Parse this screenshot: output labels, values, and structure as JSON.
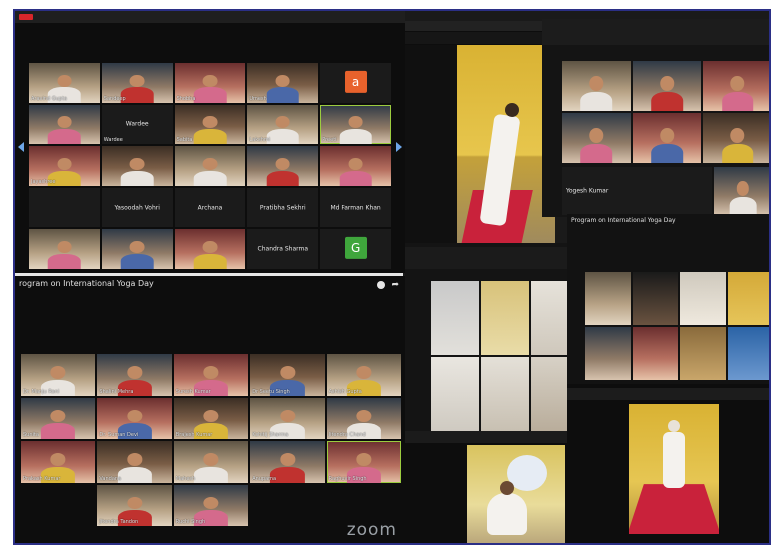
{
  "frame": {
    "border_color": "#2b2f86"
  },
  "main_window": {
    "titlebar_text": "",
    "gallery_rows": [
      [
        {
          "name": "Aravind Gupta",
          "kind": "vid"
        },
        {
          "name": "Sandeep",
          "kind": "vid"
        },
        {
          "name": "Shobha",
          "kind": "vid"
        },
        {
          "name": "Umesh",
          "kind": "vid"
        },
        {
          "name": "",
          "kind": "avatar",
          "avatar": "a",
          "color": "#e8622c"
        }
      ],
      [
        {
          "name": "",
          "kind": "vid"
        },
        {
          "name": "Wardee",
          "kind": "text",
          "text": "Wardee"
        },
        {
          "name": "Sabita",
          "kind": "vid"
        },
        {
          "name": "Lakshmi",
          "kind": "vid"
        },
        {
          "name": "Preeti",
          "kind": "vid",
          "hl": true
        }
      ],
      [
        {
          "name": "Jayashree",
          "kind": "vid"
        },
        {
          "name": "",
          "kind": "vid"
        },
        {
          "name": "",
          "kind": "vid"
        },
        {
          "name": "",
          "kind": "vid"
        },
        {
          "name": "",
          "kind": "vid"
        }
      ],
      [
        {
          "name": "",
          "kind": "text",
          "text": ""
        },
        {
          "name": "",
          "kind": "text",
          "text": "Yasoodah Vohri"
        },
        {
          "name": "",
          "kind": "text",
          "text": "Archana"
        },
        {
          "name": "",
          "kind": "text",
          "text": "Pratibha Sekhri"
        },
        {
          "name": "",
          "kind": "text",
          "text": "Md Farman Khan"
        }
      ],
      [
        {
          "name": "",
          "kind": "vid"
        },
        {
          "name": "",
          "kind": "vid"
        },
        {
          "name": "",
          "kind": "vid"
        },
        {
          "name": "",
          "kind": "text",
          "text": "Chandra Sharma"
        },
        {
          "name": "",
          "kind": "avatar",
          "avatar": "G",
          "color": "#3fa63c"
        }
      ]
    ]
  },
  "second_window": {
    "title": "rogram on International Yoga Day",
    "watermark": "zoom",
    "gallery_rows": [
      [
        {
          "name": "Dr. Manju Rani",
          "kind": "vid"
        },
        {
          "name": "Shalini Mehra",
          "kind": "vid"
        },
        {
          "name": "Suresh Kumar",
          "kind": "vid"
        },
        {
          "name": "Dr Seetu Singh",
          "kind": "vid"
        },
        {
          "name": "Ashish Gupta",
          "kind": "vid"
        }
      ],
      [
        {
          "name": "Sunita",
          "kind": "vid"
        },
        {
          "name": "Dr. Suman Devi",
          "kind": "vid"
        },
        {
          "name": "Brajesh Kumar",
          "kind": "vid"
        },
        {
          "name": "Kshitij Sharma",
          "kind": "vid"
        },
        {
          "name": "Jitendra Chand",
          "kind": "vid"
        }
      ],
      [
        {
          "name": "Prakash Kumar",
          "kind": "vid"
        },
        {
          "name": "Vandana",
          "kind": "vid"
        },
        {
          "name": "Mahesh",
          "kind": "vid"
        },
        {
          "name": "Anupama",
          "kind": "vid"
        },
        {
          "name": "Raghuvir Singh",
          "kind": "vid",
          "hl": true
        }
      ],
      [
        {
          "name": "",
          "kind": "none"
        },
        {
          "name": "Jitendra Tandon",
          "kind": "vid"
        },
        {
          "name": "Ruchi Singh",
          "kind": "vid"
        },
        {
          "name": "",
          "kind": "none"
        },
        {
          "name": "",
          "kind": "none"
        }
      ]
    ]
  },
  "third_window": {
    "speaker_label": "Yogesh Kumar",
    "side_rows": [
      [
        {
          "name": "",
          "kind": "vid"
        },
        {
          "name": "",
          "kind": "vid"
        },
        {
          "name": "",
          "kind": "vid"
        }
      ],
      [
        {
          "name": "",
          "kind": "vid"
        },
        {
          "name": "",
          "kind": "vid"
        },
        {
          "name": "",
          "kind": "vid"
        }
      ]
    ]
  },
  "fourth_window": {
    "title": "Program on International Yoga Day"
  },
  "nav": {
    "left_arrow": "◀",
    "right_arrow": "▶"
  }
}
